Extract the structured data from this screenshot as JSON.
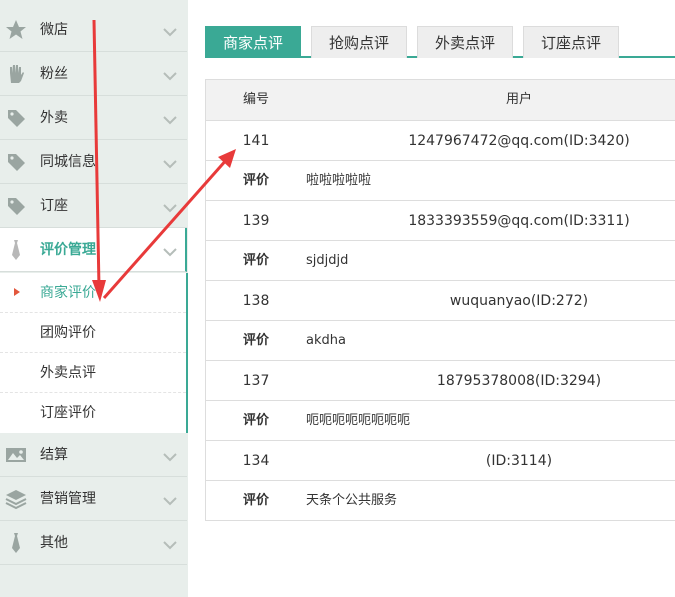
{
  "sidebar": {
    "items": [
      {
        "label": "微店",
        "icon": "star-icon"
      },
      {
        "label": "粉丝",
        "icon": "hand-icon"
      },
      {
        "label": "外卖",
        "icon": "tag-icon"
      },
      {
        "label": "同城信息",
        "icon": "tag-icon"
      },
      {
        "label": "订座",
        "icon": "tag-icon"
      },
      {
        "label": "评价管理",
        "icon": "tie-icon",
        "active": true
      },
      {
        "label": "结算",
        "icon": "picture-icon"
      },
      {
        "label": "营销管理",
        "icon": "layers-icon"
      },
      {
        "label": "其他",
        "icon": "tie-icon"
      }
    ],
    "submenu": [
      {
        "label": "商家评价",
        "active": true
      },
      {
        "label": "团购评价"
      },
      {
        "label": "外卖点评"
      },
      {
        "label": "订座评价"
      }
    ]
  },
  "tabs": [
    {
      "label": "商家点评",
      "active": true
    },
    {
      "label": "抢购点评"
    },
    {
      "label": "外卖点评"
    },
    {
      "label": "订座点评"
    }
  ],
  "table": {
    "headers": [
      "编号",
      "用户"
    ],
    "review_label": "评价",
    "rows": [
      {
        "id": "141",
        "user": "1247967472@qq.com(ID:3420)",
        "review": "啦啦啦啦啦"
      },
      {
        "id": "139",
        "user": "1833393559@qq.com(ID:3311)",
        "review": "sjdjdjd"
      },
      {
        "id": "138",
        "user": "wuquanyao(ID:272)",
        "review": "akdha"
      },
      {
        "id": "137",
        "user": "18795378008(ID:3294)",
        "review": "呃呃呃呃呃呃呃呃"
      },
      {
        "id": "134",
        "user": "(ID:3114)",
        "review": "天条个公共服务"
      }
    ]
  },
  "colors": {
    "accent": "#3aa995",
    "annotation": "#e83a3a",
    "bullet": "#e2573d"
  }
}
